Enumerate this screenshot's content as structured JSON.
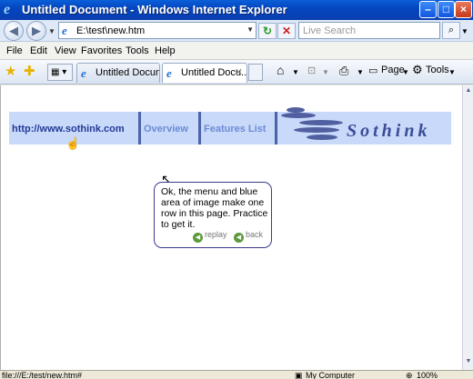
{
  "window": {
    "title": "Untitled Document - Windows Internet Explorer"
  },
  "nav": {
    "address_value": "E:\\test\\new.htm",
    "search_placeholder": "Live Search"
  },
  "menubar": {
    "items": [
      "File",
      "Edit",
      "View",
      "Favorites",
      "Tools",
      "Help"
    ]
  },
  "tabs": [
    {
      "label": "Untitled Document"
    },
    {
      "label": "Untitled Docu..."
    }
  ],
  "commands": {
    "page_label": "Page",
    "tools_label": "Tools"
  },
  "page": {
    "url_link": "http://www.sothink.com",
    "menu_items": [
      "Overview",
      "Features List"
    ],
    "logo_text": "Sothink",
    "tooltip_text": "Ok, the menu and blue area of image make one row in this page. Practice to get it.",
    "replay_label": "replay",
    "back_label": "back"
  },
  "status": {
    "left_text": "file:///E:/test/new.htm#",
    "zone_text": "My Computer",
    "zoom_text": "100%"
  },
  "colors": {
    "title_bar": "#0a4fc8",
    "menu_band": "#c8d9f9",
    "link": "#233a96",
    "menu_text": "#6b8bd6",
    "logo": "#3a4d96"
  }
}
